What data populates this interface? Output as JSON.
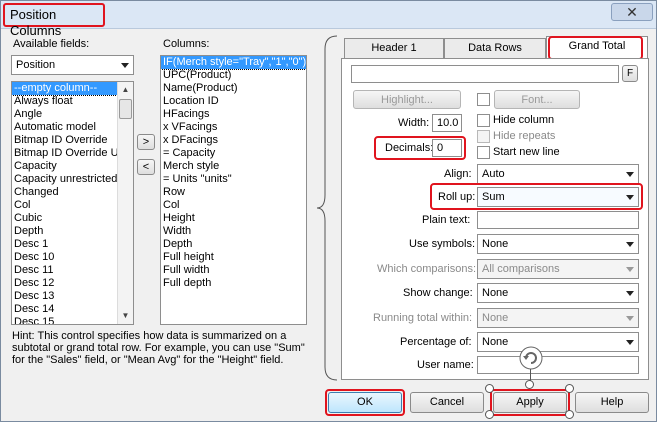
{
  "window": {
    "title": "Position Columns",
    "close_glyph": "✕"
  },
  "available": {
    "label": "Available fields:",
    "category": "Position",
    "items": [
      "--empty column--",
      "Always float",
      "Angle",
      "Automatic model",
      "Bitmap ID Override",
      "Bitmap ID Override U",
      "Capacity",
      "Capacity unrestricted",
      "Changed",
      "Col",
      "Cubic",
      "Depth",
      "Desc 1",
      "Desc 10",
      "Desc 11",
      "Desc 12",
      "Desc 13",
      "Desc 14",
      "Desc 15"
    ]
  },
  "move_buttons": {
    "add": ">",
    "remove": "<"
  },
  "columns": {
    "label": "Columns:",
    "items": [
      "IF(Merch style=\"Tray\",\"1\",\"0\")",
      "UPC(Product)",
      "Name(Product)",
      "Location ID",
      "HFacings",
      "x   VFacings",
      "x   DFacings",
      "=    Capacity",
      "Merch style",
      "=    Units \"units\"",
      "Row",
      "Col",
      "Height",
      "Width",
      "Depth",
      "Full height",
      "Full width",
      "Full depth"
    ]
  },
  "hint": "Hint:  This control specifies how data is summarized on a subtotal or grand total row. For example, you can use \"Sum\" for the \"Sales\" field, or \"Mean Avg\" for the \"Height\" field.",
  "tabs": [
    {
      "label": "Header 1"
    },
    {
      "label": "Data Rows"
    },
    {
      "label": "Grand Total"
    }
  ],
  "grand_total": {
    "formula_button": "F",
    "highlight_button": "Highlight...",
    "font_button": "Font...",
    "width_label": "Width:",
    "width_value": "10.0",
    "decimals_label": "Decimals:",
    "decimals_value": "0",
    "hide_column": "Hide column",
    "hide_repeats": "Hide repeats",
    "start_new_line": "Start new line",
    "align_label": "Align:",
    "align_value": "Auto",
    "rollup_label": "Roll up:",
    "rollup_value": "Sum",
    "plain_text_label": "Plain text:",
    "use_symbols_label": "Use symbols:",
    "use_symbols_value": "None",
    "which_comparisons_label": "Which comparisons:",
    "which_comparisons_value": "All comparisons",
    "show_change_label": "Show change:",
    "show_change_value": "None",
    "running_total_label": "Running total within:",
    "running_total_value": "None",
    "percentage_label": "Percentage of:",
    "percentage_value": "None",
    "user_name_label": "User name:"
  },
  "footer": {
    "ok": "OK",
    "cancel": "Cancel",
    "apply": "Apply",
    "help": "Help"
  },
  "colors": {
    "highlight": "#e0141e",
    "selection": "#3399ff"
  }
}
